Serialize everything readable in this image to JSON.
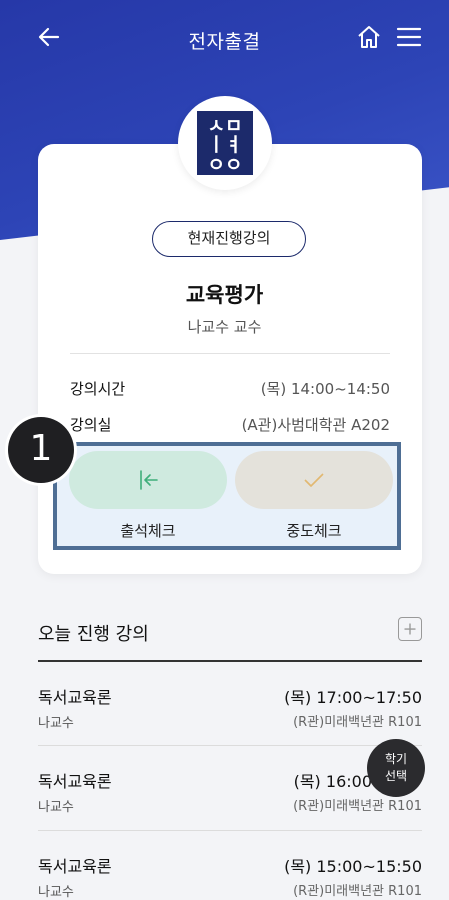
{
  "header": {
    "title": "전자출결",
    "back_icon": "arrow-left-icon",
    "home_icon": "home-icon",
    "menu_icon": "hamburger-icon"
  },
  "colors": {
    "primary": "#2d44b6",
    "navy": "#1c2a6b",
    "attendance_btn": "#cfeadf",
    "midcheck_btn": "#e4e2db",
    "callout_border": "#4e6e94"
  },
  "logo": {
    "lines": [
      "ㅅㅁ",
      "ㅣㅕ",
      "ㅇㅇ"
    ]
  },
  "current": {
    "tag": "현재진행강의",
    "course": "교육평가",
    "professor": "나교수 교수",
    "time_label": "강의시간",
    "time_value": "(목) 14:00~14:50",
    "room_label": "강의실",
    "room_value": "(A관)사범대학관 A202",
    "attendance_label": "출석체크",
    "midcheck_label": "중도체크"
  },
  "callout": {
    "number": "1"
  },
  "today": {
    "title": "오늘 진행 강의",
    "rows": [
      {
        "name": "독서교육론",
        "teacher": "나교수",
        "time": "(목) 17:00~17:50",
        "room": "(R관)미래백년관 R101"
      },
      {
        "name": "독서교육론",
        "teacher": "나교수",
        "time": "(목) 16:00",
        "room": "(R관)미래백년관 R101"
      },
      {
        "name": "독서교육론",
        "teacher": "나교수",
        "time": "(목) 15:00~15:50",
        "room": "(R관)미래백년관 R101"
      }
    ]
  },
  "fab": {
    "line1": "학기",
    "line2": "선택"
  }
}
